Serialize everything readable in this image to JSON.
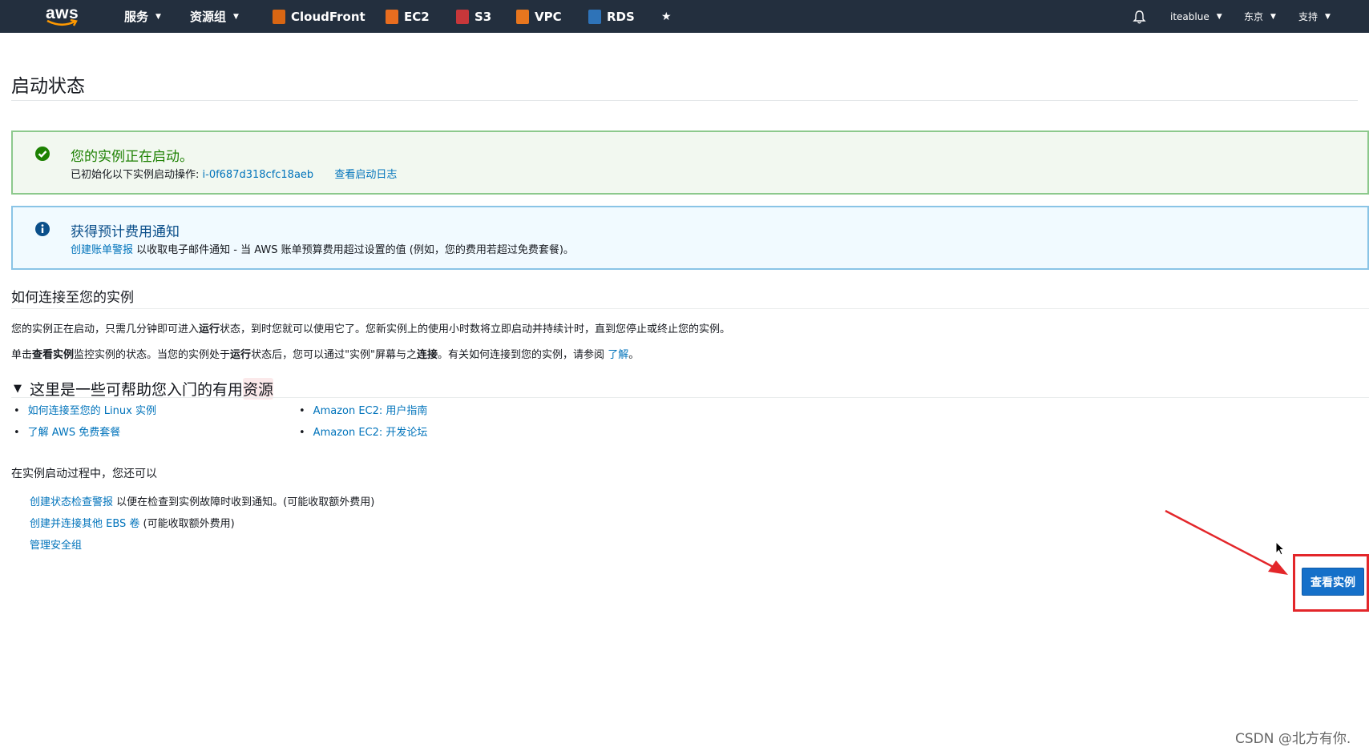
{
  "topnav": {
    "logo": "aws",
    "services": "服务",
    "resource_groups": "资源组",
    "pinned": [
      {
        "label": "CloudFront",
        "icon": "cloudfront-icon",
        "color": "#d86613"
      },
      {
        "label": "EC2",
        "icon": "ec2-icon",
        "color": "#e86d1f"
      },
      {
        "label": "S3",
        "icon": "s3-icon",
        "color": "#c7373a"
      },
      {
        "label": "VPC",
        "icon": "vpc-icon",
        "color": "#e7761e"
      },
      {
        "label": "RDS",
        "icon": "rds-icon",
        "color": "#2e73b8"
      }
    ],
    "pin_icon": "pin-icon",
    "bell_icon": "bell-icon",
    "user": "iteablue",
    "region": "东京",
    "support": "支持"
  },
  "page": {
    "title": "启动状态"
  },
  "alert_success": {
    "title": "您的实例正在启动。",
    "body_prefix": "已初始化以下实例启动操作: ",
    "instance_id": "i-0f687d318cfc18aeb",
    "log_link": "查看启动日志",
    "color": "#1d8102"
  },
  "alert_info": {
    "title": "获得预计费用通知",
    "link": "创建账单警报",
    "body": " 以收取电子邮件通知 - 当 AWS 账单预算费用超过设置的值 (例如，您的费用若超过免费套餐)。",
    "color": "#0073bb"
  },
  "connect": {
    "heading": "如何连接至您的实例",
    "p1_a": "您的实例正在启动，只需几分钟即可进入",
    "p1_b": "运行",
    "p1_c": "状态，到时您就可以使用它了。您新实例上的使用小时数将立即启动并持续计时，直到您停止或终止您的实例。",
    "p2_a": "单击",
    "p2_b": "查看实例",
    "p2_c": "监控实例的状态。当您的实例处于",
    "p2_d": "运行",
    "p2_e": "状态后，您可以通过\"实例\"屏幕与之",
    "p2_f": "连接",
    "p2_g": "。有关如何连接到您的实例，请参阅 ",
    "p2_link": "了解",
    "p2_end": "。"
  },
  "resources": {
    "heading_a": "这里是一些可帮助您入门的有用",
    "heading_b": "资源",
    "col1": [
      "如何连接至您的 Linux 实例",
      "了解 AWS 免费套餐"
    ],
    "col2": [
      "Amazon EC2: 用户指南",
      "Amazon EC2: 开发论坛"
    ]
  },
  "during": {
    "heading": "在实例启动过程中，您还可以",
    "items": [
      {
        "link": "创建状态检查警报",
        "suffix": " 以便在检查到实例故障时收到通知。(可能收取额外费用)"
      },
      {
        "link": "创建并连接其他 EBS 卷",
        "suffix": " (可能收取额外费用)"
      },
      {
        "link": "管理安全组",
        "suffix": ""
      }
    ]
  },
  "view_button": "查看实例",
  "annotation_color": "#e3262a",
  "watermark": "CSDN @北方有你."
}
